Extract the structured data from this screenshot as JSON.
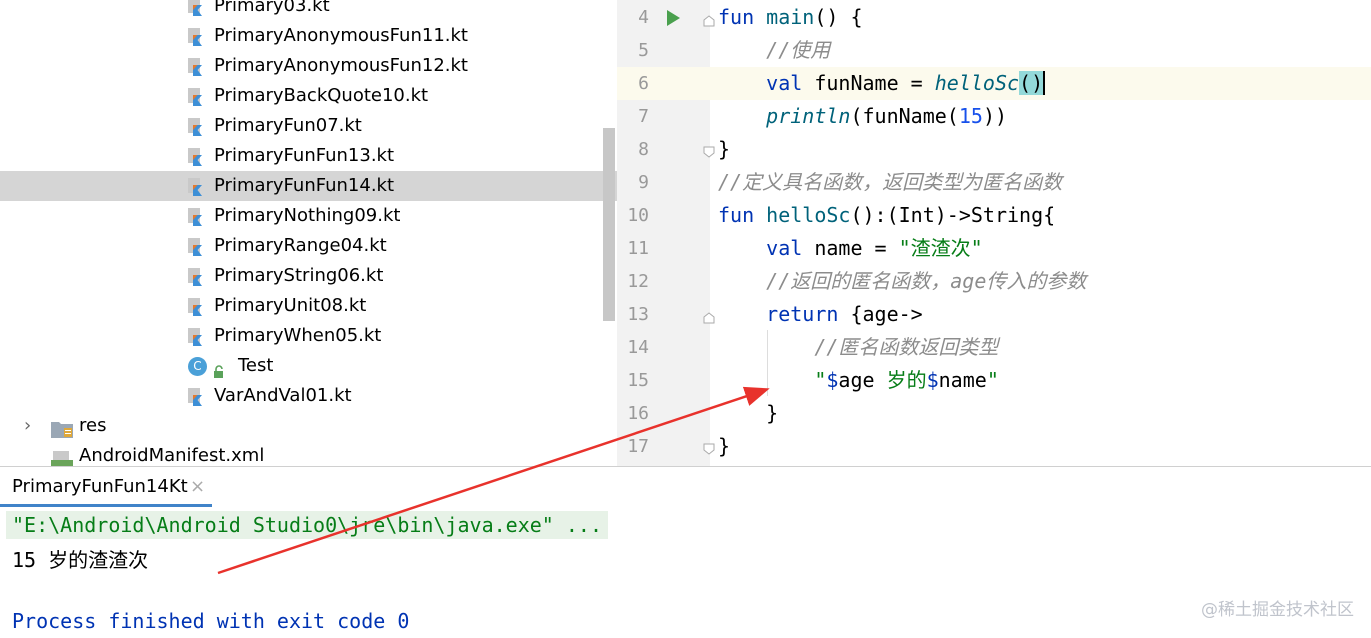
{
  "project_tree": {
    "files": [
      {
        "label": "Primary03.kt",
        "selected": false
      },
      {
        "label": "PrimaryAnonymousFun11.kt",
        "selected": false
      },
      {
        "label": "PrimaryAnonymousFun12.kt",
        "selected": false
      },
      {
        "label": "PrimaryBackQuote10.kt",
        "selected": false
      },
      {
        "label": "PrimaryFun07.kt",
        "selected": false
      },
      {
        "label": "PrimaryFunFun13.kt",
        "selected": false
      },
      {
        "label": "PrimaryFunFun14.kt",
        "selected": true
      },
      {
        "label": "PrimaryNothing09.kt",
        "selected": false
      },
      {
        "label": "PrimaryRange04.kt",
        "selected": false
      },
      {
        "label": "PrimaryString06.kt",
        "selected": false
      },
      {
        "label": "PrimaryUnit08.kt",
        "selected": false
      },
      {
        "label": "PrimaryWhen05.kt",
        "selected": false
      }
    ],
    "test_class": {
      "badge": "C",
      "label": "Test"
    },
    "last_file": {
      "label": "VarAndVal01.kt"
    },
    "res_folder": {
      "label": "res"
    },
    "manifest": {
      "label": "AndroidManifest.xml",
      "badge": "MF"
    }
  },
  "editor": {
    "line_numbers": [
      "4",
      "5",
      "6",
      "7",
      "8",
      "9",
      "10",
      "11",
      "12",
      "13",
      "14",
      "15",
      "16",
      "17"
    ],
    "code": {
      "l4_kw": "fun",
      "l4_fn": "main",
      "l4_rest": "() {",
      "l5_cm": "//使用",
      "l6_kw": "val",
      "l6_mid": " funName = ",
      "l6_call": "helloSc",
      "l6_paren": "()",
      "l7_call": "println",
      "l7_mid": "(funName(",
      "l7_num": "15",
      "l7_end": "))",
      "l8": "}",
      "l9_cm": "//定义具名函数，返回类型为匿名函数",
      "l10_kw": "fun",
      "l10_fn": "helloSc",
      "l10_rest": "():(Int)->String{",
      "l11_kw": "val",
      "l11_mid": " name = ",
      "l11_str": "\"渣渣次\"",
      "l12_cm": "//返回的匿名函数，age传入的参数",
      "l13_kw": "return",
      "l13_rest": " {age->",
      "l14_cm": "//匿名函数返回类型",
      "l15_q1": "\"",
      "l15_t1": "$",
      "l15_v1": "age",
      "l15_s": " 岁的",
      "l15_t2": "$",
      "l15_v2": "name",
      "l15_q2": "\"",
      "l16": "}",
      "l17": "}"
    }
  },
  "run_panel": {
    "tab_label": "PrimaryFunFun14Kt",
    "close_icon": "×",
    "command_line": "\"E:\\Android\\Android Studio0\\jre\\bin\\java.exe\" ...",
    "output_line": "15 岁的渣渣次",
    "exit_line": "Process finished with exit code 0",
    "watermark": "@稀土掘金技术社区"
  },
  "colors": {
    "keyword": "#0033b3",
    "string": "#067d17",
    "comment": "#8c8c8c",
    "number": "#1750eb",
    "selection": "#d5d5d5",
    "annotation_arrow": "#e8322c"
  }
}
